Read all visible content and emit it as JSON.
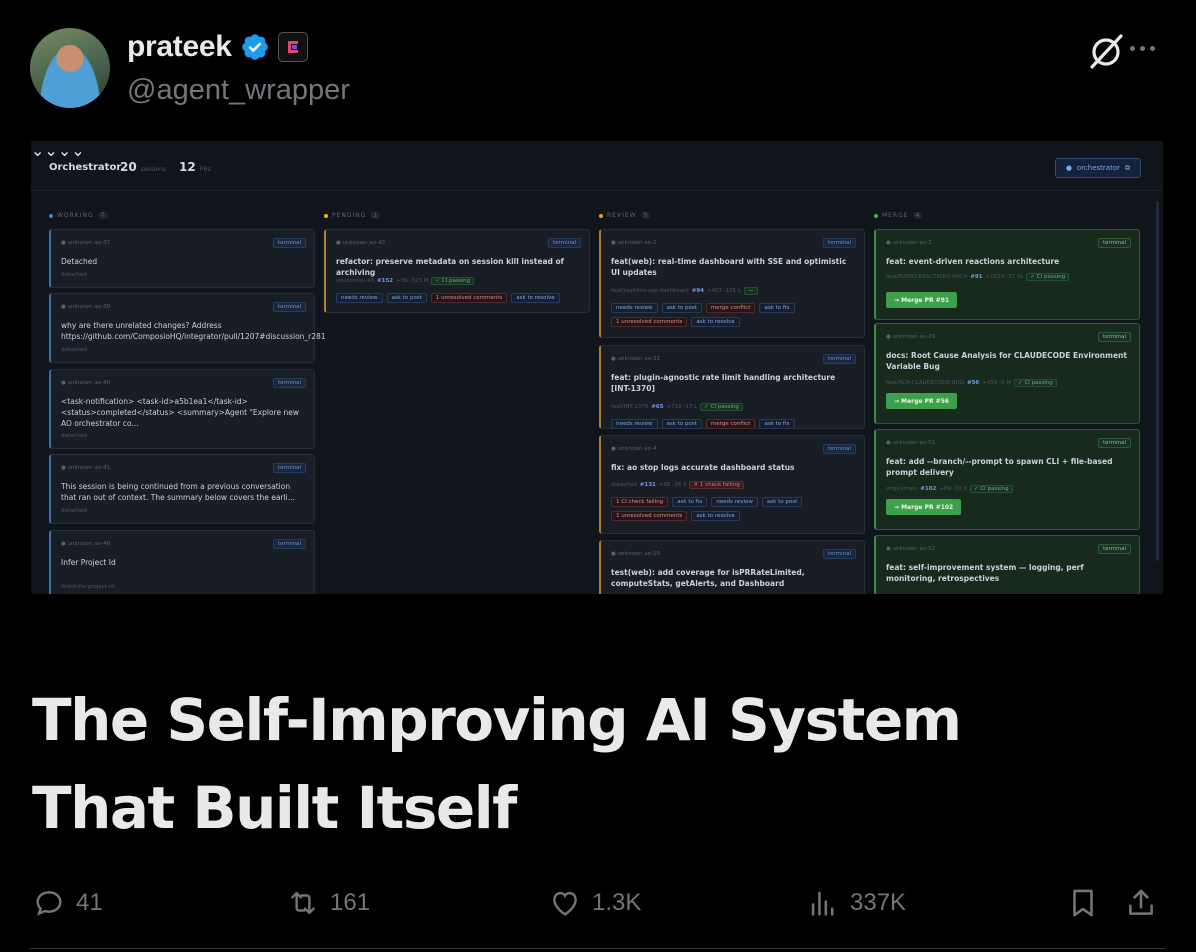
{
  "author": {
    "display_name": "prateek",
    "handle": "@agent_wrapper"
  },
  "header_icons": [
    "verified-badge-icon",
    "affiliate-badge-icon",
    "grok-icon",
    "more-icon"
  ],
  "dashboard": {
    "title": "Orchestrator",
    "sessions_count": "20",
    "sessions_label": "sessions",
    "prs_count": "12",
    "prs_label": "PRs",
    "orchestrator_button": "orchestrator",
    "columns": [
      {
        "label": "WORKING",
        "count": "7",
        "color": "#3b82f6"
      },
      {
        "label": "PENDING",
        "count": "1",
        "color": "#eab308"
      },
      {
        "label": "REVIEW",
        "count": "5",
        "color": "#f59e0b"
      },
      {
        "label": "MERGE",
        "count": "4",
        "color": "#22c55e"
      }
    ],
    "working_cards": [
      {
        "meta": "● unknown   ao-37",
        "terminal": "terminal",
        "title": "Detached",
        "sub": "detached"
      },
      {
        "meta": "● unknown   ao-39",
        "terminal": "terminal",
        "title": "why are there unrelated changes? Address https://github.com/ComposioHQ/integrator/pull/1207#discussion_r281",
        "sub": "detached"
      },
      {
        "meta": "● unknown   ao-40",
        "terminal": "terminal",
        "title": "<task-notification> <task-id>a5b1ea1</task-id> <status>completed</status> <summary>Agent \"Explore new AO orchestrator co...",
        "sub": "detached"
      },
      {
        "meta": "● unknown   ao-41",
        "terminal": "terminal",
        "title": "This session is being continued from a previous conversation that ran out of context. The summary below covers the earli...",
        "sub": "detached"
      },
      {
        "meta": "● unknown   ao-46",
        "terminal": "terminal",
        "title": "Infer Project Id",
        "sub": "feat/infer-project-id"
      }
    ],
    "pending_card": {
      "meta": "● unknown   ao-43",
      "terminal": "terminal",
      "title": "refactor: preserve metadata on session kill instead of archiving",
      "branch": "session/ao-43",
      "pr": "#152",
      "diff": "+39 -323 M",
      "ci": "✓ CI passing",
      "chips": [
        "needs review",
        "ask to post",
        "1 unresolved comments",
        "ask to resolve"
      ]
    },
    "review_cards": [
      {
        "meta": "● unknown   ao-1",
        "terminal": "terminal",
        "title": "feat(web): real-time dashboard with SSE and optimistic UI updates",
        "branch": "feat/realtime-sse-dashboard",
        "pr": "#94",
        "diff": "+407 -101 L",
        "extra": "—",
        "chips": [
          "needs review",
          "ask to post",
          "merge conflict",
          "ask to fix",
          "1 unresolved comments",
          "ask to resolve"
        ]
      },
      {
        "meta": "● unknown   ao-31",
        "terminal": "terminal",
        "title": "feat: plugin-agnostic rate limit handling architecture [INT-1370]",
        "branch": "feat/INT-1370",
        "pr": "#65",
        "diff": "+718 -17 L",
        "extra": "✓ CI passing",
        "chips": [
          "needs review",
          "ask to post",
          "merge conflict",
          "ask to fix"
        ]
      },
      {
        "meta": "● unknown   ao-4",
        "terminal": "terminal",
        "title": "fix: ao stop logs accurate dashboard status",
        "branch": "detached",
        "pr": "#131",
        "diff": "+98 -26 S",
        "extra": "✕ 1 check failing",
        "chips": [
          "1 CI check failing",
          "ask to fix",
          "needs review",
          "ask to post",
          "1 unresolved comments",
          "ask to resolve"
        ]
      },
      {
        "meta": "● unknown   ao-10",
        "terminal": "terminal",
        "title": "test(web): add coverage for isPRRateLimited, computeStats, getAlerts, and Dashboard"
      }
    ],
    "merge_cards": [
      {
        "meta": "● unknown   ao-2",
        "terminal": "terminal",
        "title": "feat: event-driven reactions architecture",
        "branch": "feat/EVENT-REACTIONS-ARCH",
        "pr": "#91",
        "diff": "+1629 -37 XL",
        "ci": "✓ CI passing",
        "button": "→ Merge PR #91"
      },
      {
        "meta": "● unknown   ao-29",
        "terminal": "terminal",
        "title": "docs: Root Cause Analysis for CLAUDECODE Environment Variable Bug",
        "branch": "feat/RCA-CLAUDECODE-BUG",
        "pr": "#56",
        "diff": "+453 -0 M",
        "ci": "✓ CI passing",
        "button": "→ Merge PR #56"
      },
      {
        "meta": "● unknown   ao-51",
        "terminal": "terminal",
        "title": "feat: add --branch/--prompt to spawn CLI + file-based prompt delivery",
        "branch": "origin/main",
        "pr": "#102",
        "diff": "+69 -33 S",
        "ci": "✓ CI passing",
        "button": "→ Merge PR #102"
      },
      {
        "meta": "● unknown   ao-52",
        "terminal": "terminal",
        "title": "feat: self-improvement system — logging, perf monitoring, retrospectives"
      }
    ]
  },
  "headline": {
    "line1": "The Self-Improving AI System",
    "line2": "That Built Itself"
  },
  "actions": {
    "replies": "41",
    "reposts": "161",
    "likes": "1.3K",
    "views": "337K"
  }
}
